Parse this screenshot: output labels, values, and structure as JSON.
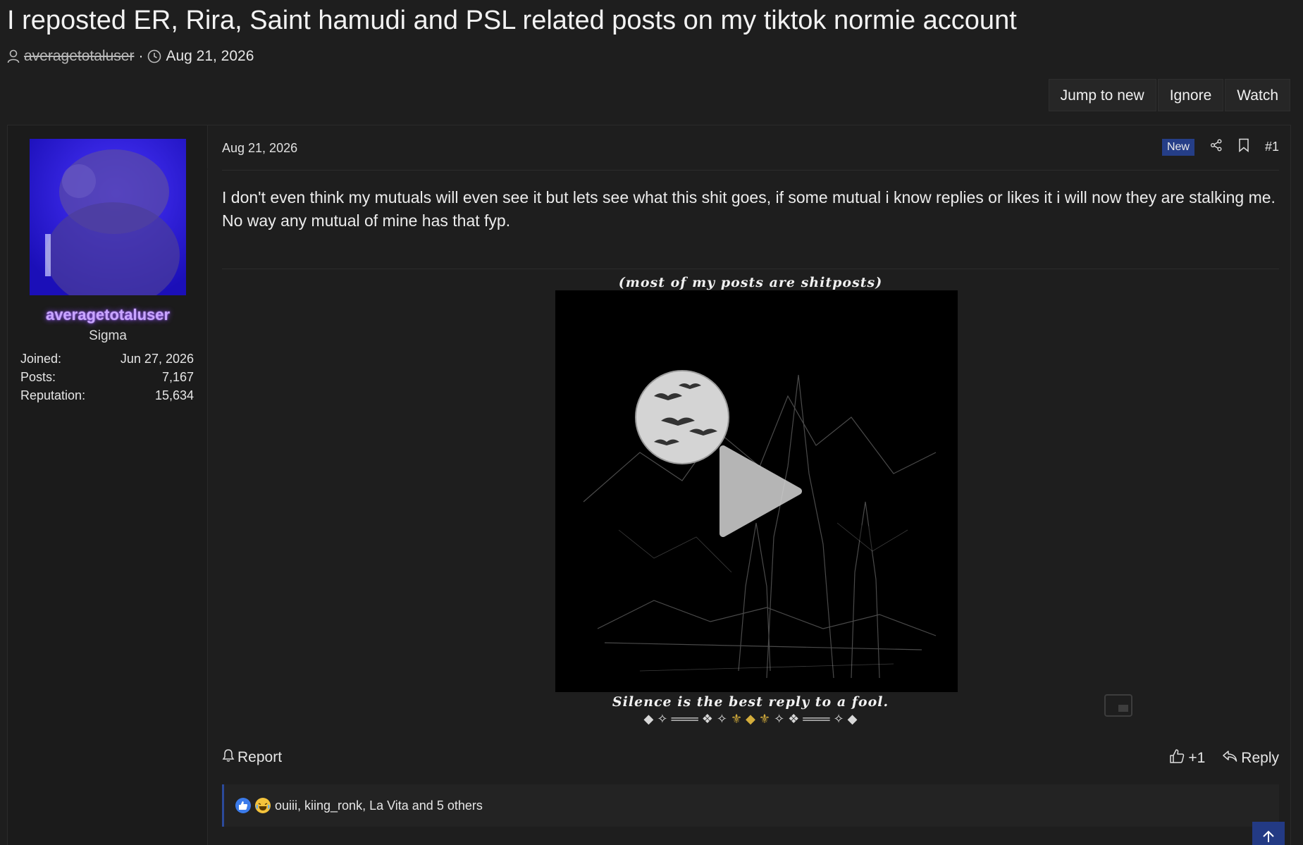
{
  "thread": {
    "title": "I reposted ER, Rira, Saint hamudi and PSL related posts on my tiktok normie account",
    "author": "averagetotaluser",
    "separator": "·",
    "date": "Aug 21, 2026"
  },
  "thread_actions": {
    "jump_to_new": "Jump to new",
    "ignore": "Ignore",
    "watch": "Watch"
  },
  "user": {
    "name": "averagetotaluser",
    "title": "Sigma",
    "stats": [
      {
        "label": "Joined:",
        "value": "Jun 27, 2026"
      },
      {
        "label": "Posts:",
        "value": "7,167"
      },
      {
        "label": "Reputation:",
        "value": "15,634"
      }
    ]
  },
  "post": {
    "date": "Aug 21, 2026",
    "badge": "New",
    "number": "#1",
    "body_lines": [
      "I don't even think my mutuals will even see it but lets see what this shit goes, if some mutual i know replies or likes it i will now they are stalking me.",
      "No way any mutual of mine has that fyp."
    ],
    "report_label": "Report",
    "like_label": "+1",
    "reply_label": "Reply"
  },
  "signature": {
    "top": "(most of my posts are shitposts)",
    "bottom": "Silence is the best reply to a fool.",
    "ornament_left": "◆ ✧ ═══ ❖ ✧",
    "ornament_center": "⚜ ◆ ⚜",
    "ornament_right": "✧ ❖ ═══ ✧ ◆"
  },
  "reactions": {
    "text": "ouiii, kiing_ronk, La Vita and 5 others",
    "icons": [
      "like-icon",
      "laugh-icon"
    ]
  },
  "colors": {
    "background": "#1e1e1e",
    "accent": "#253e87",
    "username_glow": "#8e4dff"
  }
}
